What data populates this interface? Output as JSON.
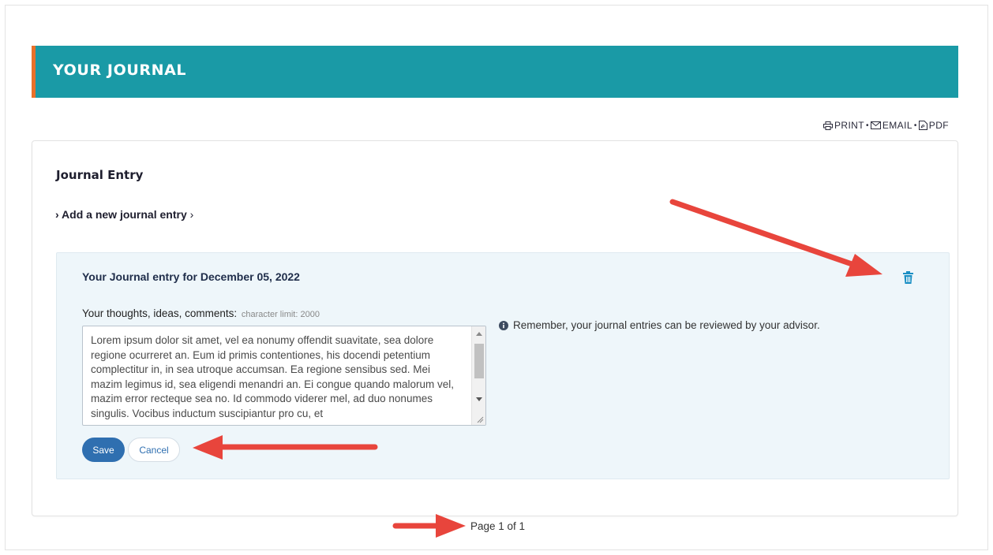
{
  "banner": {
    "title": "YOUR JOURNAL"
  },
  "actions": {
    "print": "PRINT",
    "email": "EMAIL",
    "pdf": "PDF",
    "separator": "•"
  },
  "card": {
    "title": "Journal Entry",
    "add_entry_prefix": "›",
    "add_entry_label": "Add a new journal entry",
    "add_entry_suffix": "›"
  },
  "entry": {
    "title": "Your Journal entry for December 05, 2022",
    "thoughts_label": "Your thoughts, ideas, comments:",
    "character_limit": "character limit: 2000",
    "text": "Lorem ipsum dolor sit amet, vel ea nonumy offendit suavitate, sea dolore regione ocurreret an. Eum id primis contentiones, his docendi petentium complectitur in, in sea utroque accumsan. Ea regione sensibus sed. Mei mazim legimus id, sea eligendi menandri an. Ei congue quando malorum vel, mazim error recteque sea no. Id commodo viderer mel, ad duo nonumes singulis. Vocibus inductum suscipiantur pro cu, et",
    "info_text": "Remember, your journal entries can be reviewed by your advisor.",
    "save_label": "Save",
    "cancel_label": "Cancel"
  },
  "pagination": {
    "text": "Page 1 of 1"
  },
  "icons": {
    "print": "printer-icon",
    "email": "envelope-icon",
    "pdf": "pdf-file-icon",
    "trash": "trash-icon",
    "info": "info-circle-icon"
  },
  "colors": {
    "banner": "#1a9aa6",
    "banner_accent": "#e8712a",
    "entry_background": "#eef6fa",
    "primary_button": "#2f6fb0",
    "trash_icon": "#1a8fc4",
    "annotation_arrow": "#e8453c"
  }
}
